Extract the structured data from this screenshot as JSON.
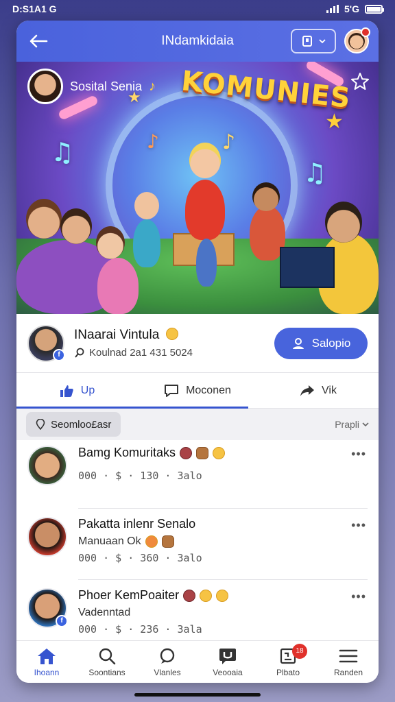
{
  "status_bar": {
    "time": "D:S1A1 G",
    "network": "5'G"
  },
  "header": {
    "title": "INdamkidaia",
    "avatar_badge": ""
  },
  "hero": {
    "owner_name": "Sosital Senia",
    "banner_text": "KOMUNIES"
  },
  "profile": {
    "name": "INaarai Vintula",
    "meta": "Koulnad 2a1 431 5024",
    "action_label": "Salopio"
  },
  "tabs": [
    {
      "label": "Up"
    },
    {
      "label": "Moconen"
    },
    {
      "label": "Vik"
    }
  ],
  "filter": {
    "chip_label": "Seomloo£asr",
    "sort_label": "Prapli"
  },
  "feed": [
    {
      "title": "Bamg Komuritaks",
      "subtitle": "",
      "stats": "000 · $ · 130 · 3alo"
    },
    {
      "title": "Pakatta inlenr Senalo",
      "subtitle": "Manuaan Ok",
      "stats": "000 · $ · 360 · 3alo"
    },
    {
      "title": "Phoer KemPoaiter",
      "subtitle": "Vadenntad",
      "stats": "000 · $ · 236 · 3ala"
    }
  ],
  "bottom_nav": [
    {
      "label": "Ihoann",
      "icon": "home-icon"
    },
    {
      "label": "Soontians",
      "icon": "search-icon"
    },
    {
      "label": "Vlanles",
      "icon": "chat-icon"
    },
    {
      "label": "Veooaia",
      "icon": "message-icon"
    },
    {
      "label": "Plbato",
      "icon": "notification-icon",
      "badge": "18"
    },
    {
      "label": "Randen",
      "icon": "menu-icon"
    }
  ],
  "colors": {
    "accent": "#4864dc",
    "header": "#4a62dc",
    "badge": "#e0312b"
  }
}
